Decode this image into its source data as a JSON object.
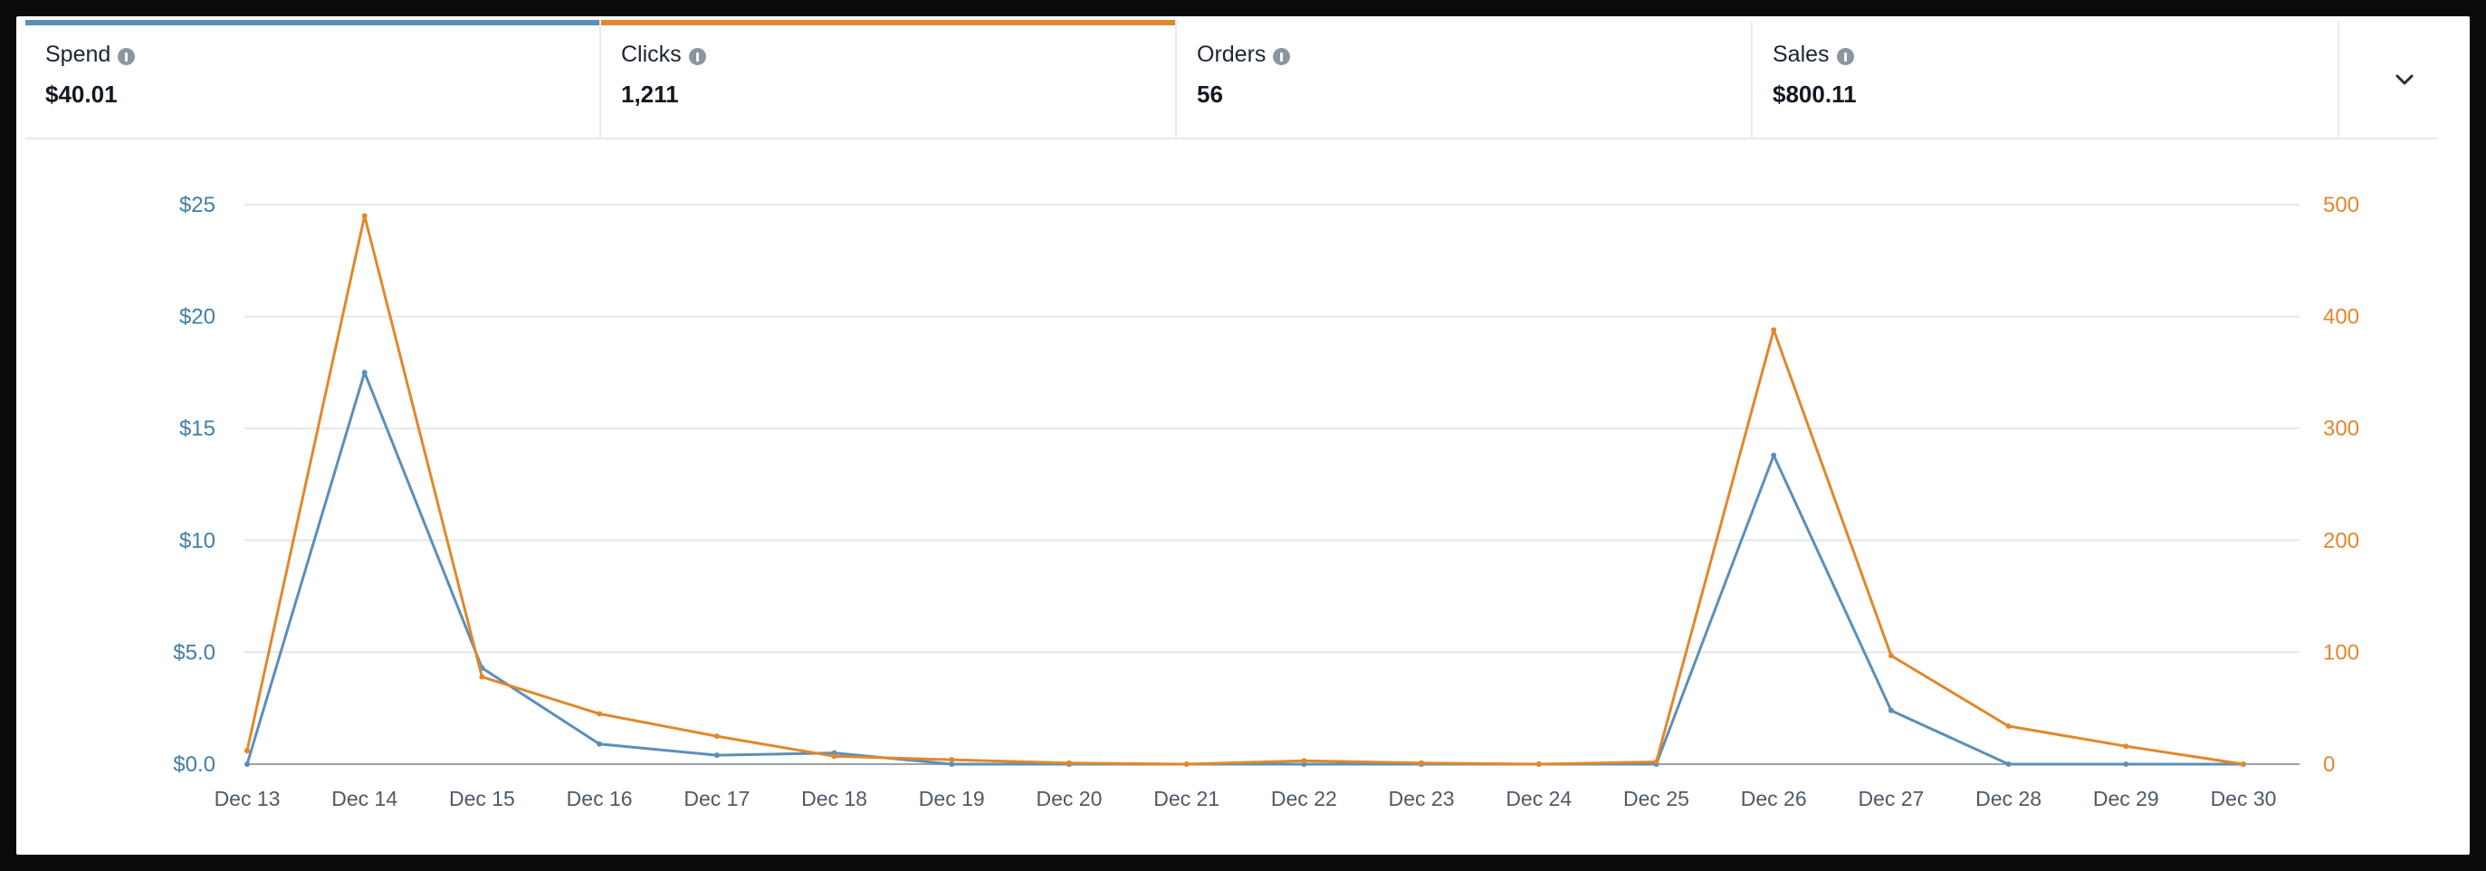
{
  "metrics": [
    {
      "label": "Spend",
      "value": "$40.01",
      "selected": true,
      "accent": "#5b8fb9"
    },
    {
      "label": "Clicks",
      "value": "1,211",
      "selected": true,
      "accent": "#e0882b"
    },
    {
      "label": "Orders",
      "value": "56",
      "selected": false,
      "accent": ""
    },
    {
      "label": "Sales",
      "value": "$800.11",
      "selected": false,
      "accent": ""
    }
  ],
  "dropdown_icon": "chevron-down-icon",
  "chart_data": {
    "type": "line",
    "categories": [
      "Dec 13",
      "Dec 14",
      "Dec 15",
      "Dec 16",
      "Dec 17",
      "Dec 18",
      "Dec 19",
      "Dec 20",
      "Dec 21",
      "Dec 22",
      "Dec 23",
      "Dec 24",
      "Dec 25",
      "Dec 26",
      "Dec 27",
      "Dec 28",
      "Dec 29",
      "Dec 30"
    ],
    "series": [
      {
        "name": "Spend",
        "axis": "left",
        "color": "#5b8fb9",
        "values": [
          0,
          17.5,
          4.3,
          0.9,
          0.4,
          0.5,
          0,
          0,
          0,
          0,
          0,
          0,
          0,
          13.8,
          2.4,
          0,
          0,
          0
        ]
      },
      {
        "name": "Clicks",
        "axis": "right",
        "color": "#e0882b",
        "values": [
          12,
          490,
          78,
          45,
          25,
          7,
          4,
          1,
          0,
          3,
          1,
          0,
          2,
          388,
          97,
          34,
          16,
          0
        ]
      }
    ],
    "y_left": {
      "ticks": [
        "$0.0",
        "$5.0",
        "$10",
        "$15",
        "$20",
        "$25"
      ],
      "range": [
        0,
        25
      ]
    },
    "y_right": {
      "ticks": [
        "0",
        "100",
        "200",
        "300",
        "400",
        "500"
      ],
      "range": [
        0,
        500
      ]
    },
    "grid": true
  }
}
